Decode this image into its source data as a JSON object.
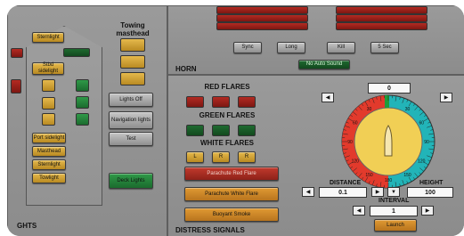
{
  "lights_panel": {
    "towing_masthead_title": "Towing masthead",
    "vessel_buttons": [
      "Sternlight",
      "Stbd sidelight",
      "Port sidelight",
      "Masthead",
      "Sternlight",
      "Towlight"
    ],
    "lights_off_label": "Lights Off",
    "navigation_lights_label": "Navigation lights",
    "test_label": "Test",
    "deck_lights_label": "Deck Lights",
    "section_title": "GHTS"
  },
  "horn_panel": {
    "title": "HORN",
    "buttons": [
      "Sync",
      "Long",
      "Kill",
      "5 Sec"
    ],
    "no_auto_sound_label": "No Auto Sound"
  },
  "distress_panel": {
    "title": "DISTRESS SIGNALS",
    "red_flares_title": "RED FLARES",
    "green_flares_title": "GREEN FLARES",
    "white_flares_title": "WHITE FLARES",
    "white_flare_letters": [
      "L",
      "R",
      "R"
    ],
    "parachute_red_label": "Parachute Red Flare",
    "parachute_white_label": "Parachute White Flare",
    "buoyant_smoke_label": "Buoyant Smoke",
    "bearing_value": "0",
    "dial_labels": [
      "0",
      "30",
      "60",
      "90",
      "120",
      "150",
      "180",
      "150",
      "120",
      "90",
      "60",
      "30"
    ],
    "distance_label": "DISTANCE",
    "distance_value": "0.1",
    "height_label": "HEIGHT",
    "height_value": "100",
    "interval_label": "INTERVAL",
    "interval_value": "1",
    "launch_label": "Launch"
  },
  "colors": {
    "panel_bg": "#8f8f8f",
    "amber": "#d8a838",
    "green": "#259040",
    "red": "#9e241c",
    "dial_port": "#e23a2c",
    "dial_starboard": "#22b4b8",
    "dial_center": "#f1cf55"
  }
}
